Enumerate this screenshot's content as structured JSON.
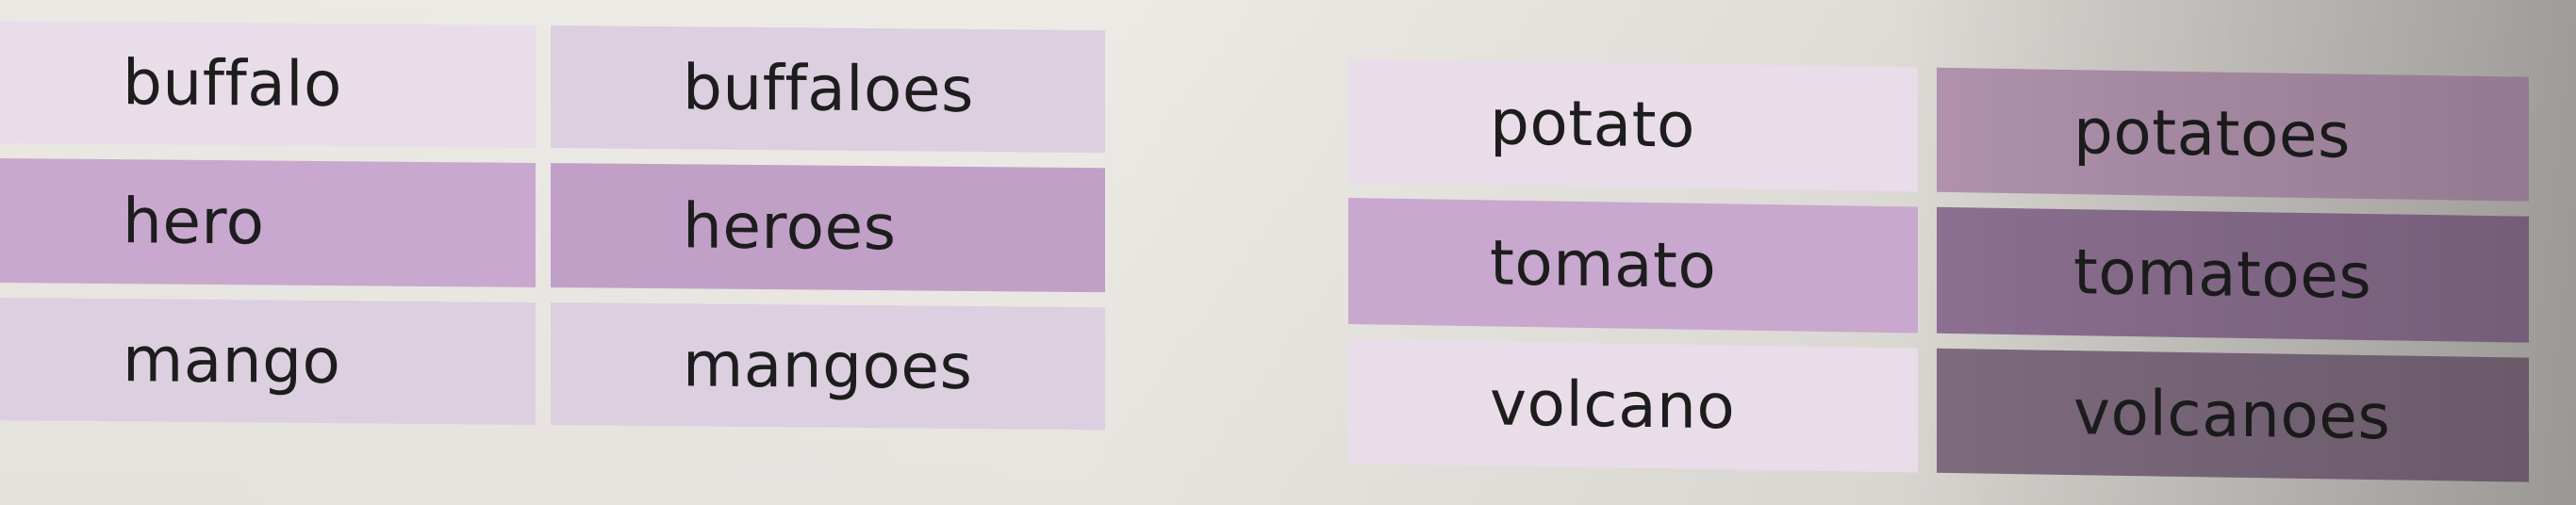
{
  "left_table": {
    "rows": [
      {
        "singular": "buffalo",
        "plural": "buffaloes"
      },
      {
        "singular": "hero",
        "plural": "heroes"
      },
      {
        "singular": "mango",
        "plural": "mangoes"
      }
    ]
  },
  "right_table": {
    "rows": [
      {
        "singular": "potato",
        "plural": "potatoes"
      },
      {
        "singular": "tomato",
        "plural": "tomatoes"
      },
      {
        "singular": "volcano",
        "plural": "volcanoes"
      }
    ]
  }
}
